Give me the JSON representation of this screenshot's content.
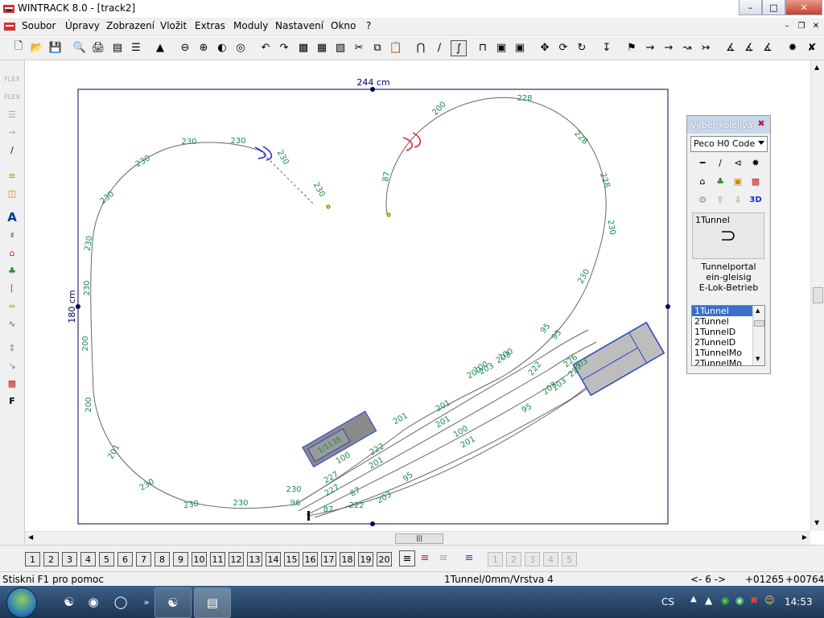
{
  "window": {
    "title": "WINTRACK 8.0 - [track2]"
  },
  "menu": [
    "Soubor",
    "Úpravy",
    "Zobrazení",
    "Vložit",
    "Extras",
    "Moduly",
    "Nastavení",
    "Okno",
    "?"
  ],
  "canvas": {
    "width_label": "244 cm",
    "height_label": "180 cm",
    "track_labels": [
      "230",
      "230",
      "230",
      "230",
      "230",
      "230",
      "200",
      "200",
      "201",
      "230",
      "230",
      "230",
      "230",
      "96",
      "87",
      "87",
      "200",
      "228",
      "228",
      "228",
      "230",
      "230",
      "230",
      "230",
      "95",
      "95",
      "95",
      "100",
      "203",
      "203",
      "200",
      "201",
      "201",
      "100",
      "201",
      "100",
      "201",
      "227",
      "227",
      "87",
      "222",
      "222",
      "203",
      "95",
      "222",
      "203",
      "100",
      "201",
      "227",
      "203",
      "203",
      "226"
    ],
    "module_label": "1/1138"
  },
  "panel": {
    "title": "Výběr kolejiva",
    "system": "Peco H0 Code",
    "selected_item": "1Tunnel",
    "desc_line1": "Tunnelportal",
    "desc_line2": "ein-gleisig",
    "desc_line3": "E-Lok-Betrieb",
    "list": [
      "1Tunnel",
      "2Tunnel",
      "1TunnelD",
      "2TunnelD",
      "1TunnelMo",
      "2TunnelMo"
    ]
  },
  "layers": [
    "1",
    "2",
    "3",
    "4",
    "5",
    "6",
    "7",
    "8",
    "9",
    "10",
    "11",
    "12",
    "13",
    "14",
    "15",
    "16",
    "17",
    "18",
    "19",
    "20"
  ],
  "status": {
    "help": "Stiskni F1 pro pomoc",
    "object": "1Tunnel/0mm/Vrstva 4",
    "arrow": "<- 6 ->",
    "x": "+01265",
    "y": "+00764"
  },
  "taskbar": {
    "lang": "CS",
    "time": "14:53"
  },
  "colors": {
    "track": "#555555",
    "label": "#1a8c4e",
    "frame": "#00005a",
    "module": "#8a8a8a",
    "module_border": "#2a44c8"
  }
}
